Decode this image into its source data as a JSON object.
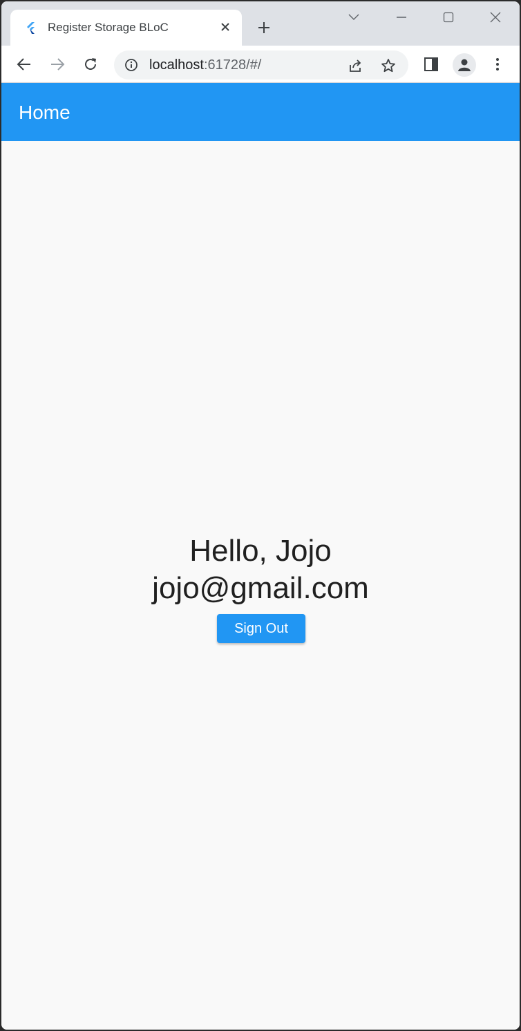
{
  "browser": {
    "tab_title": "Register Storage BLoC",
    "url_host": "localhost",
    "url_path": ":61728/#/"
  },
  "app": {
    "appbar_title": "Home",
    "greeting": "Hello, Jojo",
    "email": "jojo@gmail.com",
    "signout_label": "Sign Out"
  },
  "colors": {
    "primary": "#2196f3",
    "background": "#f9f9f9"
  }
}
